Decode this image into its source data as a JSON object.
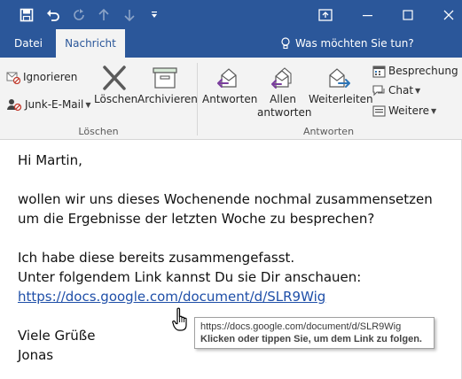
{
  "window": {
    "titlebar_color": "#2b579a",
    "quick_access": [
      {
        "name": "save-icon"
      },
      {
        "name": "undo-icon"
      },
      {
        "name": "redo-icon"
      },
      {
        "name": "up-arrow-icon"
      },
      {
        "name": "down-arrow-icon"
      },
      {
        "name": "customize-icon"
      }
    ],
    "controls": [
      "ribbon-display-icon",
      "minimize-icon",
      "maximize-icon",
      "close-icon"
    ]
  },
  "tabs": [
    {
      "label": "Datei",
      "active": false
    },
    {
      "label": "Nachricht",
      "active": true
    }
  ],
  "tell_me": {
    "label": "Was möchten Sie tun?",
    "icon": "lightbulb-icon"
  },
  "ribbon": {
    "groups": [
      {
        "label": "Löschen",
        "items": [
          {
            "label": "Ignorieren",
            "icon": "ignore-icon"
          },
          {
            "label": "Junk-E-Mail",
            "icon": "junk-icon",
            "dropdown": true
          },
          {
            "label": "Löschen",
            "icon": "delete-x-icon"
          },
          {
            "label": "Archivieren",
            "icon": "archive-icon"
          }
        ]
      },
      {
        "label": "Antworten",
        "items": [
          {
            "label": "Antworten",
            "icon": "reply-icon"
          },
          {
            "label_line1": "Allen",
            "label_line2": "antworten",
            "icon": "reply-all-icon"
          },
          {
            "label": "Weiterleiten",
            "icon": "forward-icon"
          },
          {
            "label": "Besprechung",
            "icon": "meeting-icon"
          },
          {
            "label": "Chat",
            "icon": "chat-icon",
            "dropdown": true
          },
          {
            "label": "Weitere",
            "icon": "more-icon",
            "dropdown": true
          }
        ]
      }
    ]
  },
  "message": {
    "greeting": "Hi Martin,",
    "line1": "wollen wir uns dieses Wochenende nochmal zusammensetzen",
    "line2": "um die Ergebnisse der letzten Woche zu besprechen?",
    "line3": "Ich habe diese bereits zusammengefasst.",
    "line4": "Unter folgendem Link kannst Du sie Dir anschauen:",
    "link": "https://docs.google.com/document/d/SLR9Wig",
    "closing": "Viele Grüße",
    "signature": "Jonas"
  },
  "tooltip": {
    "url": "https://docs.google.com/document/d/SLR9Wig",
    "hint": "Klicken oder tippen Sie, um dem Link zu folgen."
  },
  "colors": {
    "accent": "#2b579a",
    "link": "#1f4fa8",
    "reply_purple": "#7a3e9d",
    "forward_blue": "#2e75b6"
  }
}
